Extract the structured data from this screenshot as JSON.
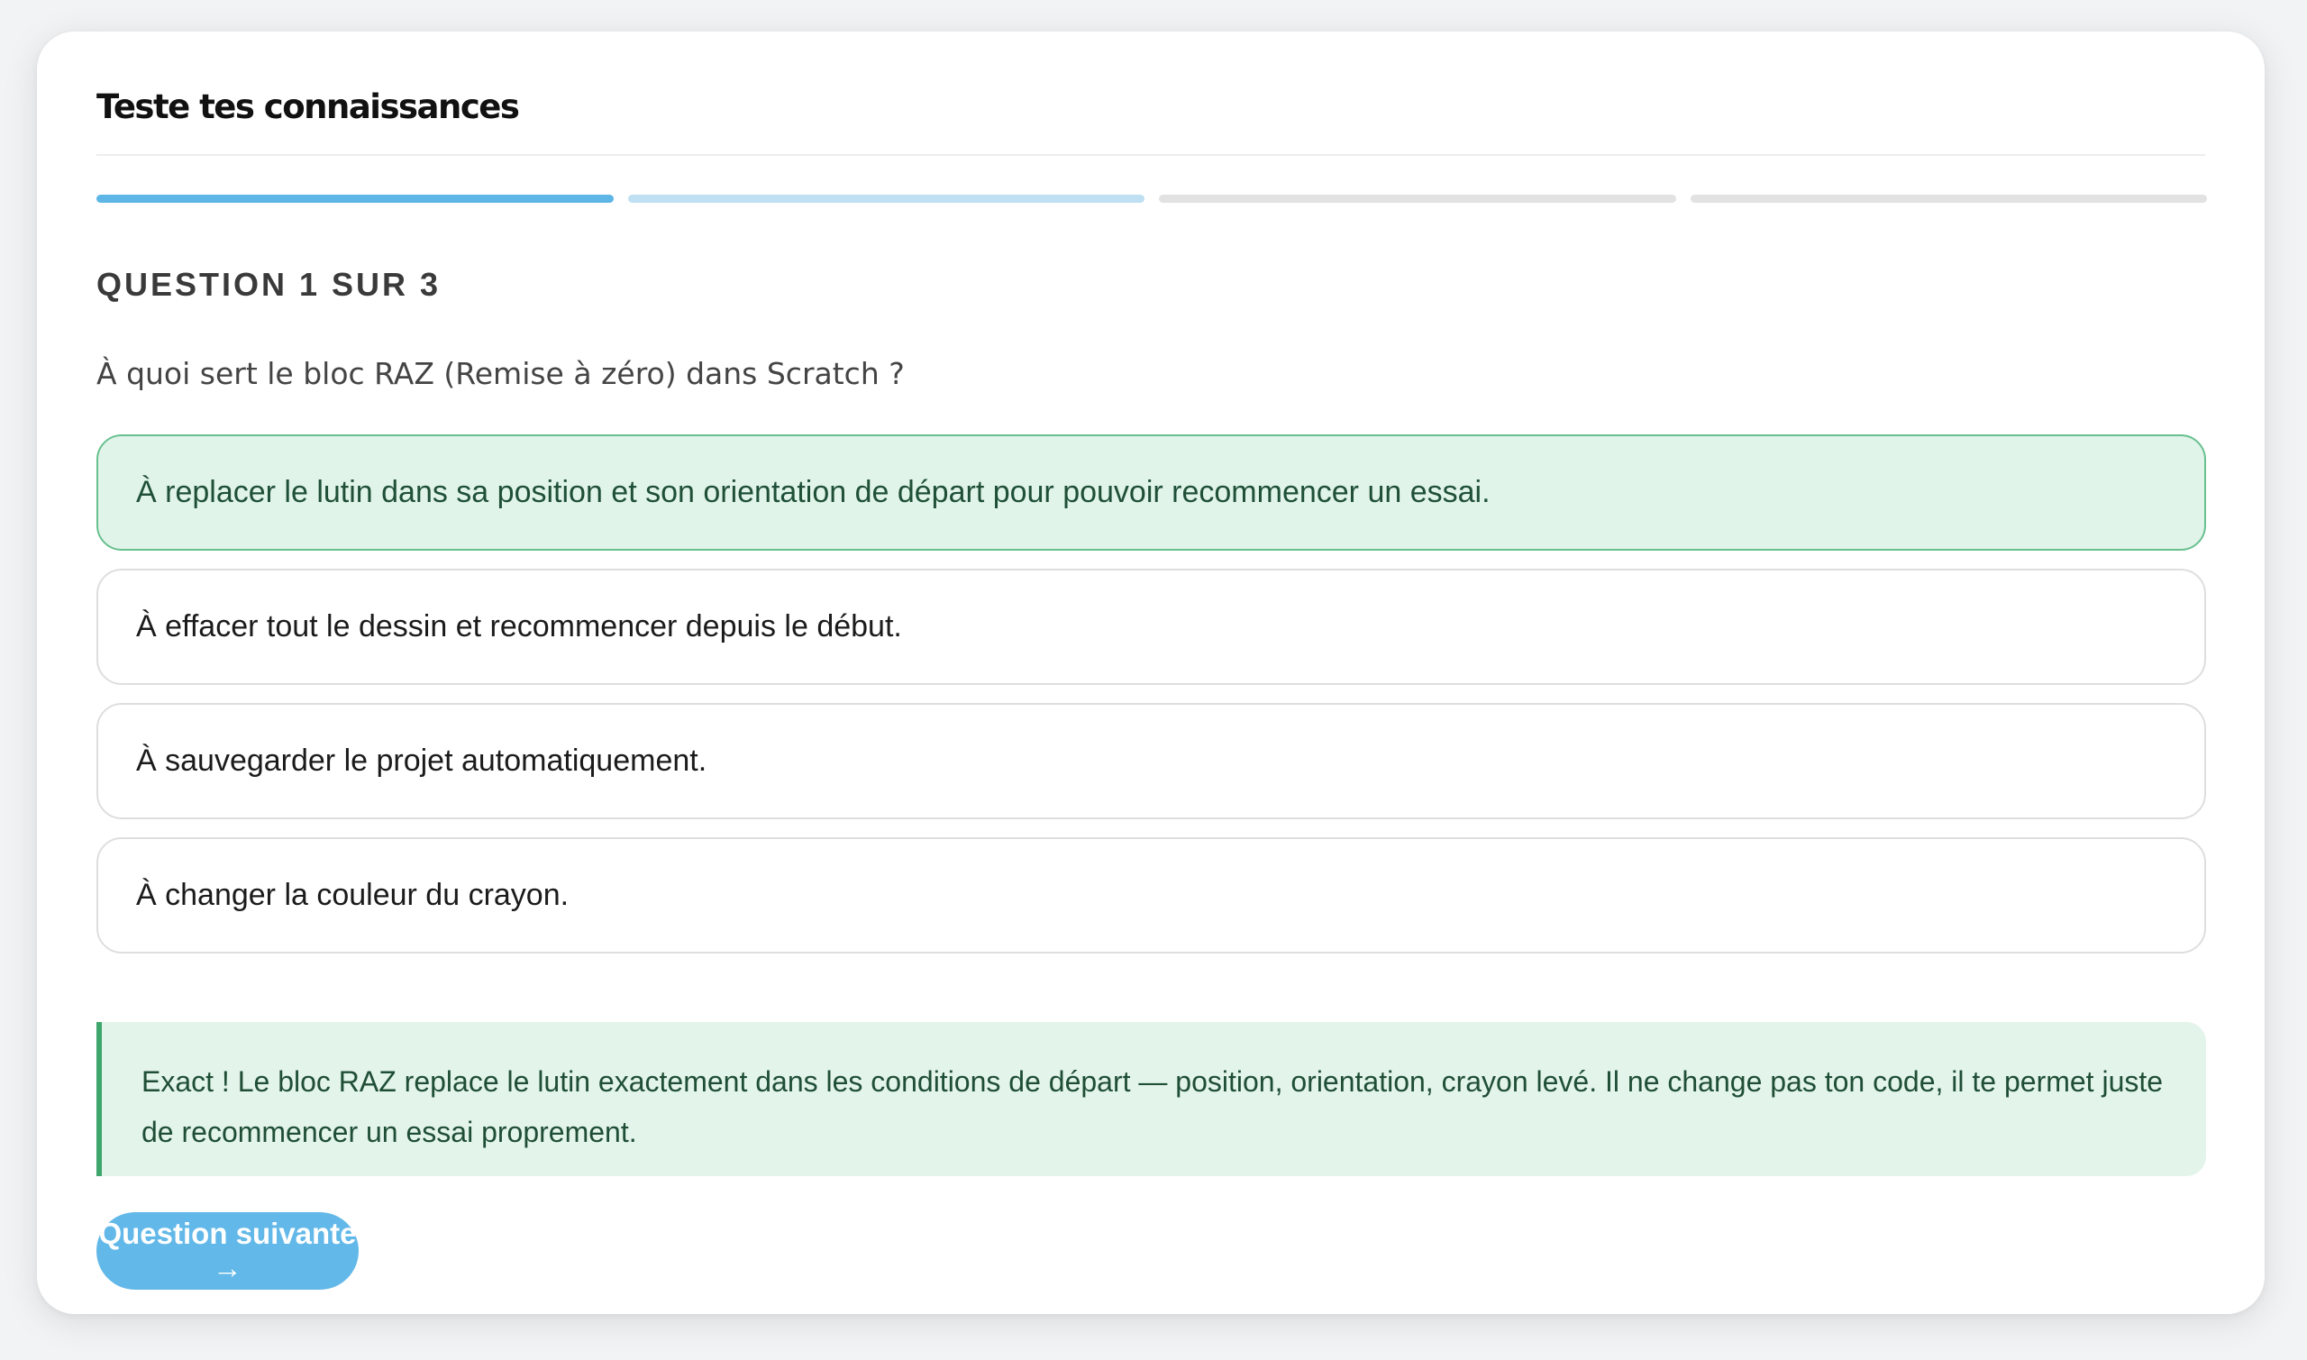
{
  "quiz": {
    "title": "Teste tes connaissances",
    "progress": {
      "segments": [
        {
          "state": "done"
        },
        {
          "state": "current"
        },
        {
          "state": "pending"
        },
        {
          "state": "pending"
        }
      ]
    },
    "question_counter": "QUESTION 1 SUR 3",
    "question": "À quoi sert le bloc RAZ (Remise à zéro) dans Scratch ?",
    "options": [
      {
        "label": "À replacer le lutin dans sa position et son orientation de départ pour pouvoir recommencer un essai.",
        "state": "correct"
      },
      {
        "label": "À effacer tout le dessin et recommencer depuis le début.",
        "state": "default"
      },
      {
        "label": "À sauvegarder le projet automatiquement.",
        "state": "default"
      },
      {
        "label": "À changer la couleur du crayon.",
        "state": "default"
      }
    ],
    "feedback": "Exact ! Le bloc RAZ replace le lutin exactement dans les conditions de départ — position, orientation, crayon levé. Il ne change pas ton code, il te permet juste de recommencer un essai proprement.",
    "next_button_label": "Question suivante →"
  },
  "colors": {
    "accent": "#5db6e6",
    "accent_light": "#bfe0f3",
    "correct_bg": "#e1f4ea",
    "correct_border": "#67c08e",
    "feedback_bar": "#3fa66e",
    "button": "#62b8e8"
  }
}
